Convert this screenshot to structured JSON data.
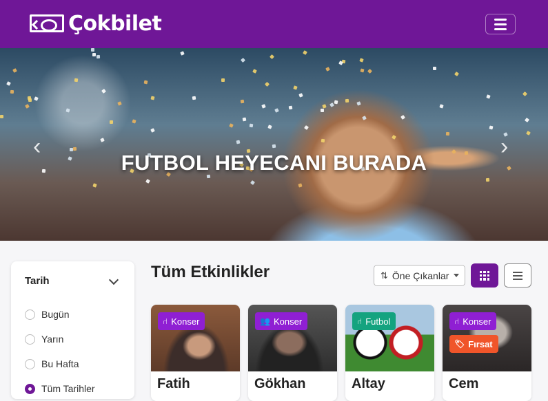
{
  "header": {
    "brand": "Çokbilet",
    "menu_icon": "hamburger-icon"
  },
  "hero": {
    "title": "FUTBOL HEYECANI BURADA",
    "prev_icon": "chevron-left-icon",
    "next_icon": "chevron-right-icon"
  },
  "filter": {
    "heading": "Tarih",
    "options": [
      {
        "label": "Bugün",
        "checked": false
      },
      {
        "label": "Yarın",
        "checked": false
      },
      {
        "label": "Bu Hafta",
        "checked": false
      },
      {
        "label": "Tüm Tarihler",
        "checked": true
      }
    ]
  },
  "events": {
    "title": "Tüm Etkinlikler",
    "sort_label": "Öne Çıkanlar",
    "cards": [
      {
        "name": "Fatih",
        "badges": [
          {
            "label": "Konser",
            "icon": "chair-icon",
            "color": "#8f1fd3"
          }
        ]
      },
      {
        "name": "Gökhan",
        "badges": [
          {
            "label": "Konser",
            "icon": "users-icon",
            "color": "#8f1fd3"
          }
        ]
      },
      {
        "name": "Altay",
        "badges": [
          {
            "label": "Futbol",
            "icon": "chair-icon",
            "color": "#14a37f"
          }
        ]
      },
      {
        "name": "Cem",
        "badges": [
          {
            "label": "Konser",
            "icon": "chair-icon",
            "color": "#8f1fd3"
          },
          {
            "label": "Fırsat",
            "icon": "tag-icon",
            "color": "#f0552a"
          }
        ]
      }
    ]
  },
  "colors": {
    "brand": "#6f1797",
    "konser": "#8f1fd3",
    "futbol": "#14a37f",
    "firsat": "#f0552a"
  }
}
